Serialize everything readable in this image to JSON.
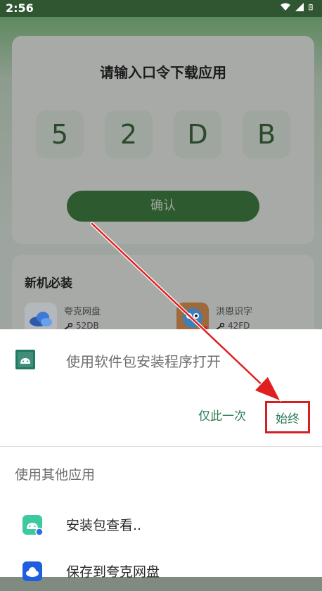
{
  "status_bar": {
    "time": "2:56",
    "icons": [
      "wifi-icon",
      "signal-icon",
      "battery-icon"
    ]
  },
  "code_card": {
    "title": "请输入口令下载应用",
    "code_chars": [
      "5",
      "2",
      "D",
      "B"
    ],
    "confirm_label": "确认"
  },
  "apps_card": {
    "title": "新机必装",
    "apps": [
      {
        "name": "夸克网盘",
        "code": "52DB",
        "icon": "cloud-icon"
      },
      {
        "name": "洪恩识字",
        "code": "42FD",
        "icon": "dragon-icon"
      }
    ]
  },
  "sheet": {
    "title": "使用软件包安装程序打开",
    "once_label": "仅此一次",
    "always_label": "始终",
    "other_label": "使用其他应用",
    "options": [
      {
        "label": "安装包查看..",
        "icon": "android-package-icon"
      },
      {
        "label": "保存到夸克网盘",
        "icon": "quark-cloud-icon"
      }
    ]
  },
  "colors": {
    "accent_green": "#2e7d55",
    "highlight_red": "#d62020",
    "dark_green": "#2e5a2f"
  }
}
